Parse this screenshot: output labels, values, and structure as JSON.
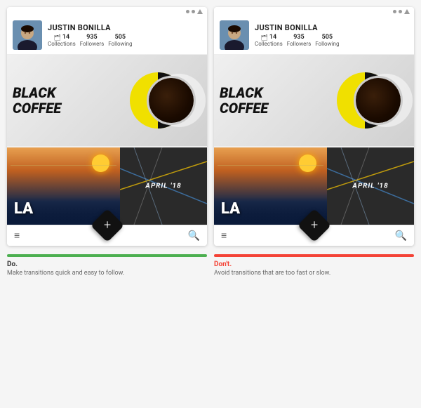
{
  "panels": [
    {
      "id": "left",
      "profile": {
        "name": "JUSTIN BONILLA",
        "collections_count": "14",
        "collections_label": "Collections",
        "followers_count": "935",
        "followers_label": "Followers",
        "following_count": "505",
        "following_label": "Following"
      },
      "coffee_title_line1": "BLACK",
      "coffee_title_line2": "COFFEE",
      "la_text": "LA",
      "april_text": "APRIL '18",
      "fab_label": "+",
      "label_bar_class": "green",
      "label_title": "Do.",
      "label_desc": "Make transitions quick and easy to follow."
    },
    {
      "id": "right",
      "profile": {
        "name": "JUSTIN BONILLA",
        "collections_count": "14",
        "collections_label": "Collections",
        "followers_count": "935",
        "followers_label": "Followers",
        "following_count": "505",
        "following_label": "Following"
      },
      "coffee_title_line1": "BLACK",
      "coffee_title_line2": "COFFEE",
      "la_text": "LA",
      "april_text": "APRIL '18",
      "fab_label": "+",
      "label_bar_class": "red",
      "label_title": "Don't.",
      "label_title_class": "dont",
      "label_desc": "Avoid transitions that are too fast or slow."
    }
  ]
}
